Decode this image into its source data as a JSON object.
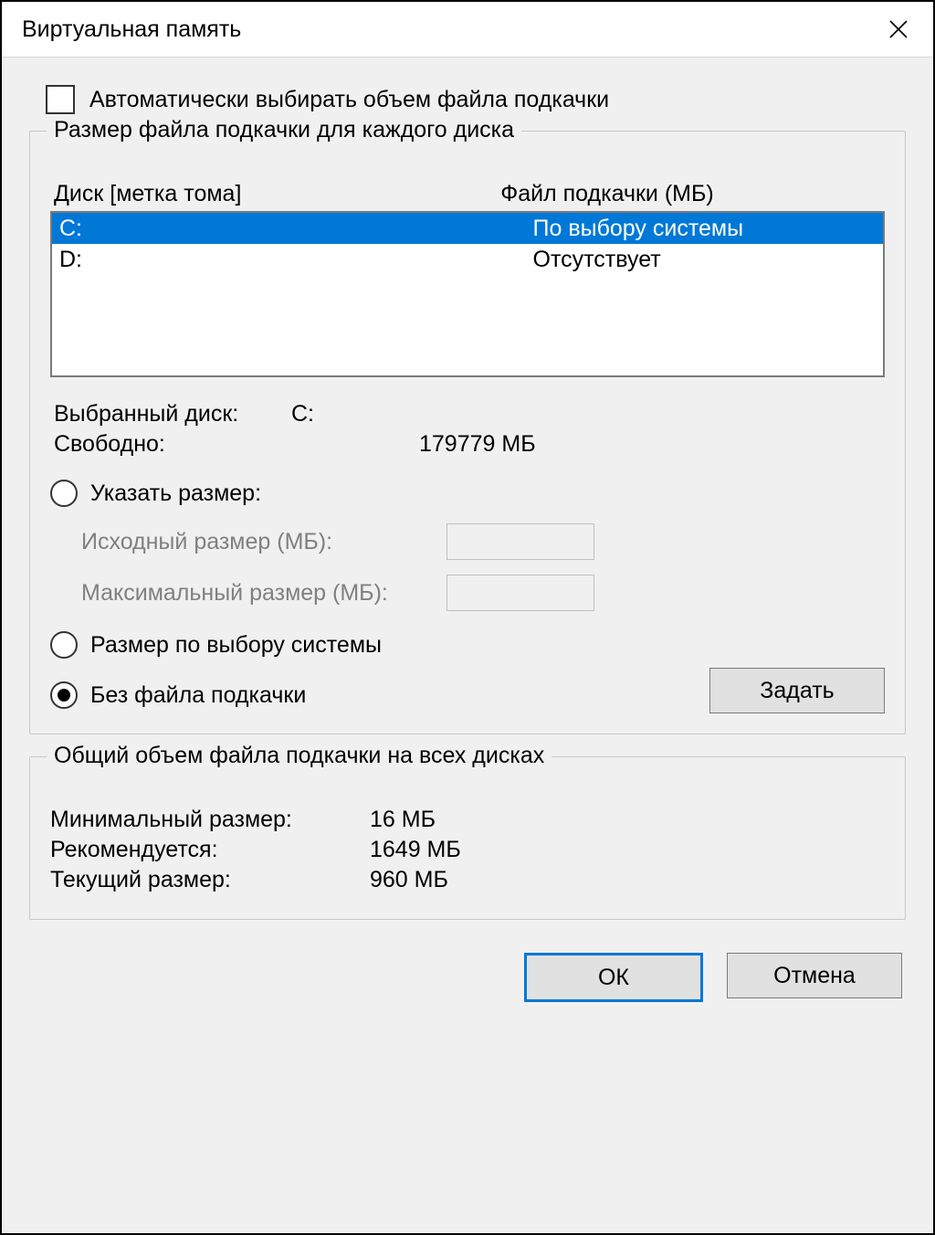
{
  "title": "Виртуальная память",
  "auto_checkbox_label": "Автоматически выбирать объем файла подкачки",
  "group1_title": "Размер файла подкачки для каждого диска",
  "col_drive": "Диск [метка тома]",
  "col_pagefile": "Файл подкачки (МБ)",
  "drives": [
    {
      "drive": "C:",
      "pagefile": "По выбору системы",
      "selected": true
    },
    {
      "drive": "D:",
      "pagefile": "Отсутствует",
      "selected": false
    }
  ],
  "selected_drive_label": "Выбранный диск:",
  "selected_drive_value": "C:",
  "free_label": "Свободно:",
  "free_value": "179779 МБ",
  "radio_custom": "Указать размер:",
  "initial_label": "Исходный размер (МБ):",
  "max_label": "Максимальный размер (МБ):",
  "radio_system": "Размер по выбору системы",
  "radio_none": "Без файла подкачки",
  "set_button": "Задать",
  "group2_title": "Общий объем файла подкачки на всех дисках",
  "min_label": "Минимальный размер:",
  "min_value": "16 МБ",
  "rec_label": "Рекомендуется:",
  "rec_value": "1649 МБ",
  "cur_label": "Текущий размер:",
  "cur_value": "960 МБ",
  "ok_button": "ОК",
  "cancel_button": "Отмена"
}
